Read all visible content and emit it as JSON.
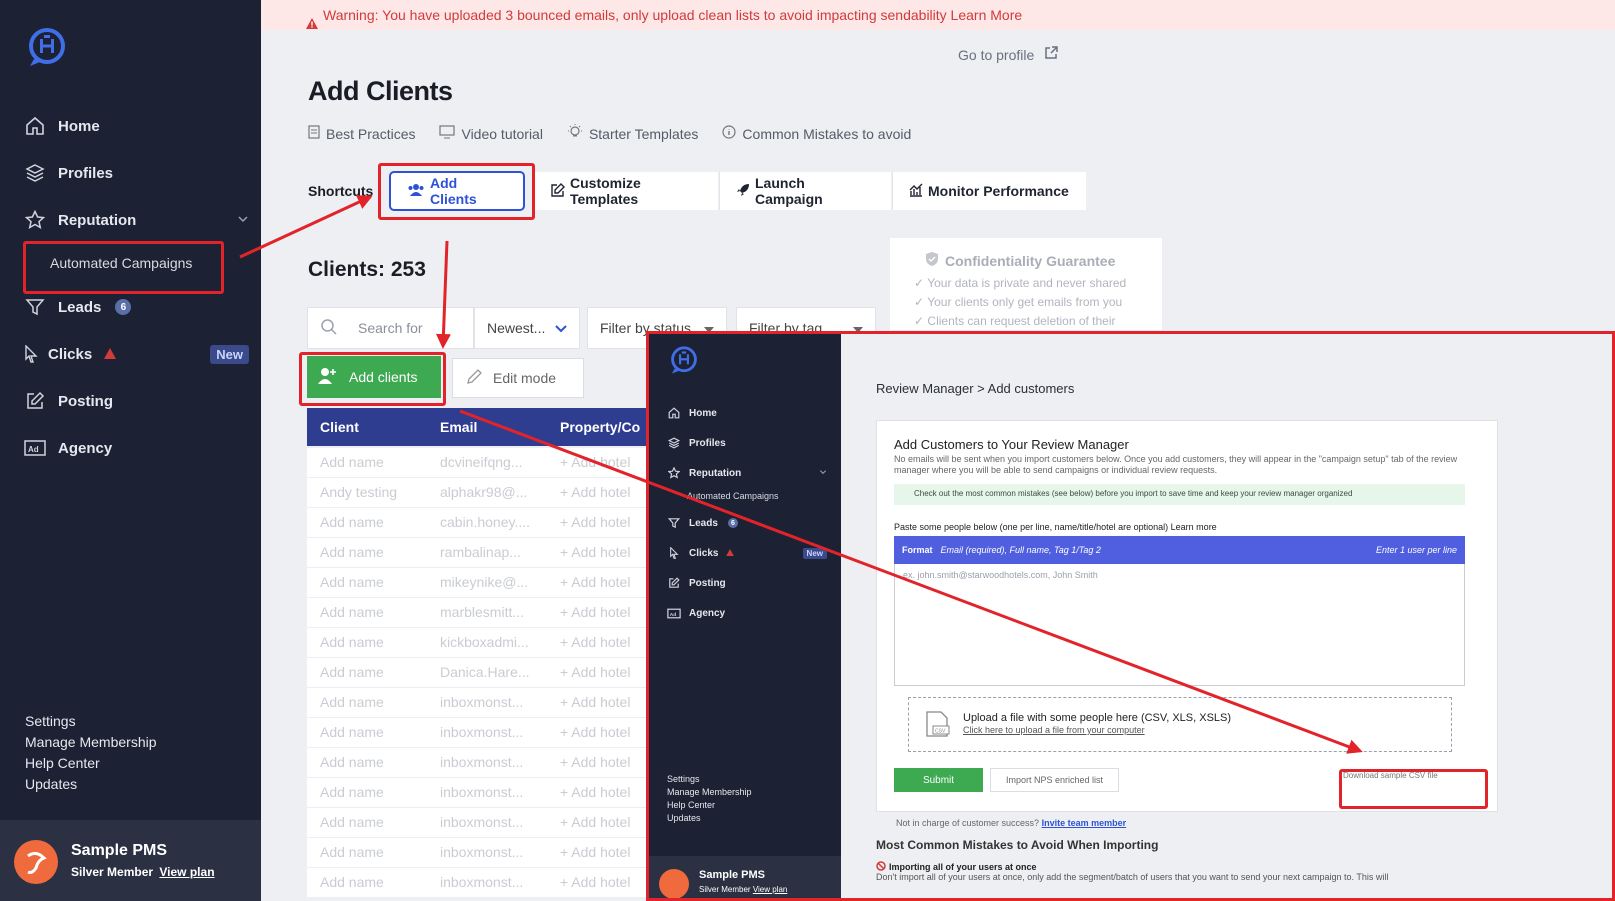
{
  "warning": {
    "text": "Warning: You have uploaded 3 bounced emails, only upload clean lists to avoid impacting sendability Learn More"
  },
  "header": {
    "go_to_profile": "Go to profile"
  },
  "page": {
    "title": "Add Clients"
  },
  "resources": [
    {
      "label": "Best Practices",
      "icon": "document-icon"
    },
    {
      "label": "Video tutorial",
      "icon": "monitor-icon"
    },
    {
      "label": "Starter Templates",
      "icon": "lightbulb-icon"
    },
    {
      "label": "Common Mistakes to avoid",
      "icon": "info-icon"
    }
  ],
  "shortcuts": {
    "label": "Shortcuts",
    "tabs": [
      {
        "label": "Add Clients",
        "icon": "users-icon"
      },
      {
        "label": "Customize Templates",
        "icon": "edit-icon"
      },
      {
        "label": "Launch Campaign",
        "icon": "rocket-icon"
      },
      {
        "label": "Monitor Performance",
        "icon": "chart-icon"
      }
    ]
  },
  "clients": {
    "title": "Clients: 253"
  },
  "filters": {
    "search_placeholder": "Search for",
    "sort": "Newest...",
    "status": "Filter by status",
    "tag": "Filter by tag"
  },
  "actions": {
    "add_clients": "Add clients",
    "edit_mode": "Edit mode"
  },
  "table": {
    "columns": [
      "Client",
      "Email",
      "Property/Co"
    ],
    "rows": [
      {
        "client": "Add name",
        "email": "dcvineifqng...",
        "property": "+ Add hotel"
      },
      {
        "client": "Andy testing",
        "email": "alphakr98@...",
        "property": "+ Add hotel"
      },
      {
        "client": "Add name",
        "email": "cabin.honey....",
        "property": "+ Add hotel"
      },
      {
        "client": "Add name",
        "email": "rambalinap...",
        "property": "+ Add hotel"
      },
      {
        "client": "Add name",
        "email": "mikeynike@...",
        "property": "+ Add hotel"
      },
      {
        "client": "Add name",
        "email": "marblesmitt...",
        "property": "+ Add hotel"
      },
      {
        "client": "Add name",
        "email": "kickboxadmi...",
        "property": "+ Add hotel"
      },
      {
        "client": "Add name",
        "email": "Danica.Hare...",
        "property": "+ Add hotel"
      },
      {
        "client": "Add name",
        "email": "inboxmonst...",
        "property": "+ Add hotel"
      },
      {
        "client": "Add name",
        "email": "inboxmonst...",
        "property": "+ Add hotel"
      },
      {
        "client": "Add name",
        "email": "inboxmonst...",
        "property": "+ Add hotel"
      },
      {
        "client": "Add name",
        "email": "inboxmonst...",
        "property": "+ Add hotel"
      },
      {
        "client": "Add name",
        "email": "inboxmonst...",
        "property": "+ Add hotel"
      },
      {
        "client": "Add name",
        "email": "inboxmonst...",
        "property": "+ Add hotel"
      },
      {
        "client": "Add name",
        "email": "inboxmonst...",
        "property": "+ Add hotel"
      }
    ]
  },
  "confidentiality": {
    "title": "Confidentiality Guarantee",
    "items": [
      "Your data is private and never shared",
      "Your clients only get emails from you",
      "Clients can request deletion of their"
    ]
  },
  "sidebar": {
    "items": [
      {
        "label": "Home",
        "icon": "home-icon"
      },
      {
        "label": "Profiles",
        "icon": "layers-icon"
      },
      {
        "label": "Reputation",
        "icon": "star-icon"
      },
      {
        "label": "Automated Campaigns"
      },
      {
        "label": "Leads",
        "icon": "filter-icon",
        "badge": "6"
      },
      {
        "label": "Clicks",
        "icon": "cursor-icon",
        "badge": "New"
      },
      {
        "label": "Posting",
        "icon": "edit-icon"
      },
      {
        "label": "Agency",
        "icon": "ad-icon"
      }
    ],
    "bottom_links": [
      "Settings",
      "Manage Membership",
      "Help Center",
      "Updates"
    ],
    "user": {
      "name": "Sample PMS",
      "plan": "Silver Member",
      "view_plan": "View plan"
    }
  },
  "overlay": {
    "sidebar": {
      "items": [
        "Home",
        "Profiles",
        "Reputation",
        "Automated Campaigns",
        "Leads",
        "Clicks",
        "Posting",
        "Agency"
      ],
      "leads_badge": "6",
      "clicks_badge": "New",
      "bottom_links": [
        "Settings",
        "Manage Membership",
        "Help Center",
        "Updates"
      ],
      "user_name": "Sample PMS",
      "user_plan": "Silver Member",
      "view_plan": "View plan"
    },
    "breadcrumb": "Review Manager > Add customers",
    "card_title": "Add Customers to Your Review Manager",
    "card_desc": "No emails will be sent when you import customers below. Once you add customers, they will appear in the \"campaign setup\" tab of the review manager where you will be able to send campaigns or individual review requests.",
    "tip": "Check out the most common mistakes (see below) before you import to save time and keep your review manager organized",
    "paste_label": "Paste some people below (one per line, name/title/hotel are optional) Learn more",
    "format_label": "Format",
    "format_desc": "Email (required), Full name, Tag 1/Tag 2",
    "format_right": "Enter 1 user per line",
    "textarea_placeholder": "ex. john.smith@starwoodhotels.com, John Smith",
    "upload_title": "Upload a file with some people here (CSV, XLS, XSLS)",
    "upload_link": "Click here to upload a file from your computer",
    "submit": "Submit",
    "import_nps": "Import NPS enriched list",
    "download_csv": "Download sample CSV file",
    "not_in_charge": "Not in charge of customer success?",
    "invite": "Invite team member",
    "mistakes_title": "Most Common Mistakes to Avoid When Importing",
    "mistake_1": "Importing all of your users at once",
    "mistake_1_desc": "Don't import all of your users at once, only add the segment/batch of users that you want to send your next campaign to. This will"
  },
  "colors": {
    "accent": "#2d52d6",
    "sidebar": "#1c2233",
    "green": "#3daa52",
    "annotation_red": "#e2242a",
    "warning_red": "#d33a3a"
  }
}
